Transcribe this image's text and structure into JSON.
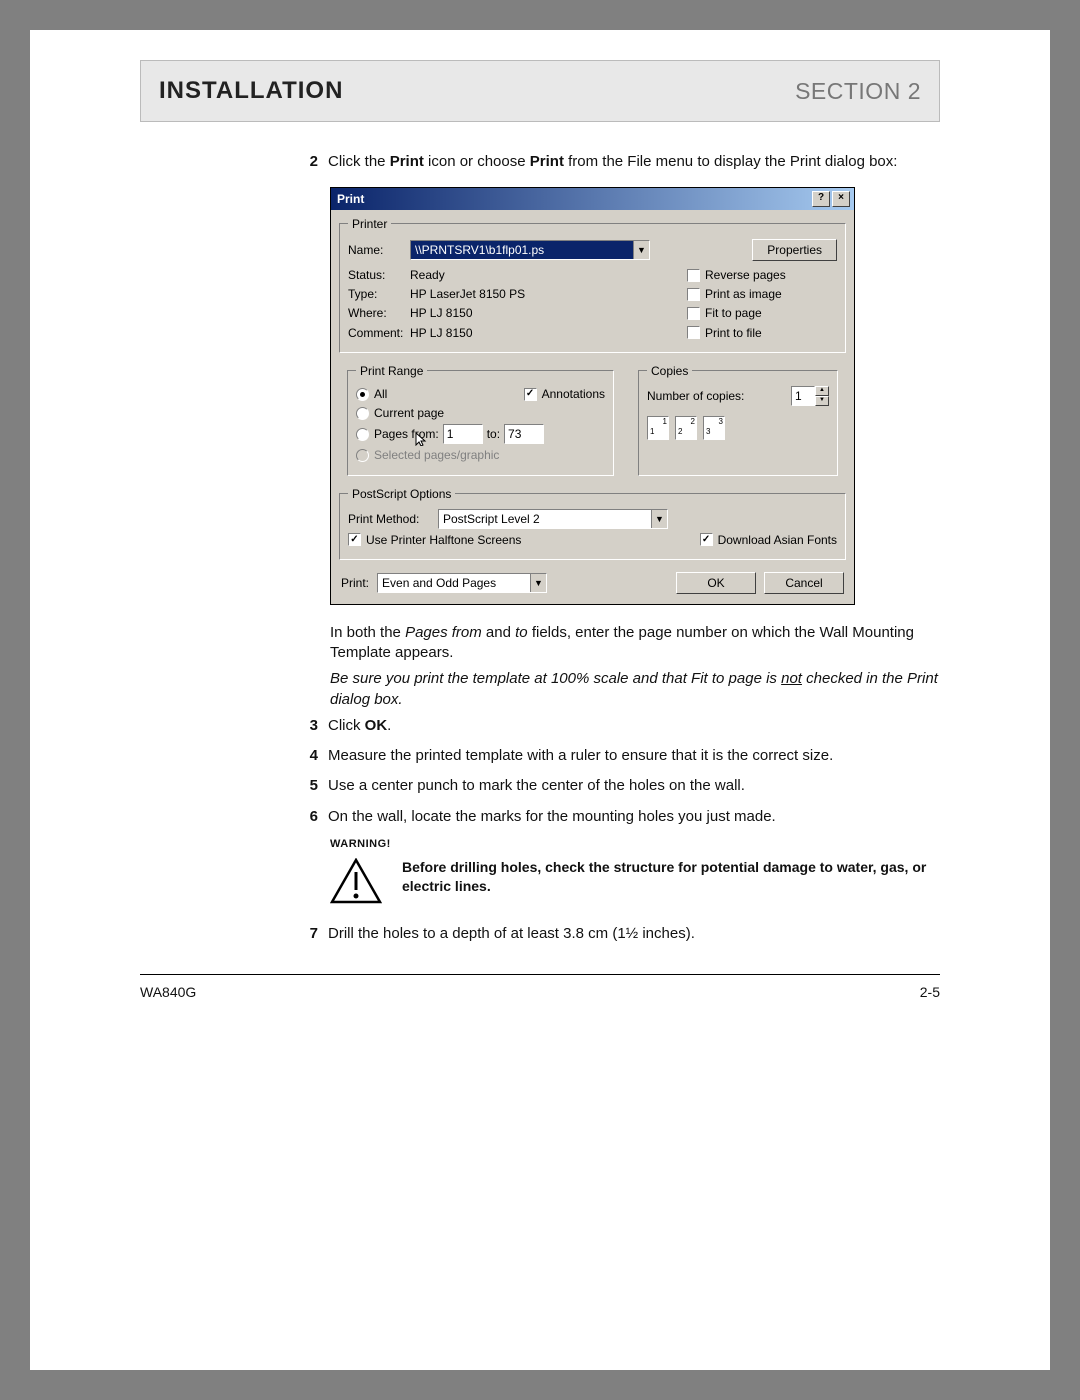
{
  "header": {
    "left": "INSTALLATION",
    "right": "SECTION 2"
  },
  "step2": {
    "num": "2",
    "pre": "Click the ",
    "bold1": "Print",
    "mid": " icon or choose ",
    "bold2": "Print",
    "post": " from the File menu to display the Print dialog box:"
  },
  "dialog": {
    "title": "Print",
    "printer_legend": "Printer",
    "name_lbl": "Name:",
    "name_val": "\\\\PRNTSRV1\\b1flp01.ps",
    "props_btn": "Properties",
    "status_lbl": "Status:",
    "status_val": "Ready",
    "type_lbl": "Type:",
    "type_val": "HP LaserJet 8150 PS",
    "where_lbl": "Where:",
    "where_val": "HP LJ 8150",
    "comment_lbl": "Comment:",
    "comment_val": "HP LJ 8150",
    "reverse_pages": "Reverse pages",
    "print_as_image": "Print as image",
    "fit_to_page": "Fit to page",
    "print_to_file": "Print to file",
    "range_legend": "Print Range",
    "all": "All",
    "annotations": "Annotations",
    "current_page": "Current page",
    "pages_from": "Pages from:",
    "pages_from_val": "1",
    "to_lbl": "to:",
    "to_val": "73",
    "selected_pages": "Selected pages/graphic",
    "copies_legend": "Copies",
    "num_copies_lbl": "Number of copies:",
    "num_copies_val": "1",
    "ps_legend": "PostScript Options",
    "pm_lbl": "Print Method:",
    "pm_val": "PostScript Level 2",
    "halftone": "Use Printer Halftone Screens",
    "asian": "Download Asian Fonts",
    "print_lbl": "Print:",
    "print_val": "Even and Odd Pages",
    "ok": "OK",
    "cancel": "Cancel"
  },
  "note1_a": "In both the ",
  "note1_b": "Pages from",
  "note1_c": " and ",
  "note1_d": "to",
  "note1_e": " fields, enter the page number on which the Wall Mounting Template appears.",
  "note2_a": "Be sure you print the template at 100% scale and that Fit to page is ",
  "note2_b": "not",
  "note2_c": " checked in the Print dialog box.",
  "s3": {
    "num": "3",
    "a": "Click ",
    "b": "OK",
    "c": "."
  },
  "s4": {
    "num": "4",
    "t": "Measure the printed template with a ruler to ensure that it is the correct size."
  },
  "s5": {
    "num": "5",
    "t": "Use a center punch to mark the center of the holes on the wall."
  },
  "s6": {
    "num": "6",
    "t": "On the wall, locate the marks for the mounting holes you just made."
  },
  "warning": {
    "label": "WARNING!",
    "text": "Before drilling holes, check the structure for potential damage to water, gas, or electric lines."
  },
  "s7": {
    "num": "7",
    "t": "Drill the holes to a depth of at least 3.8 cm (1½ inches)."
  },
  "footer": {
    "left": "WA840G",
    "right": "2-5"
  }
}
